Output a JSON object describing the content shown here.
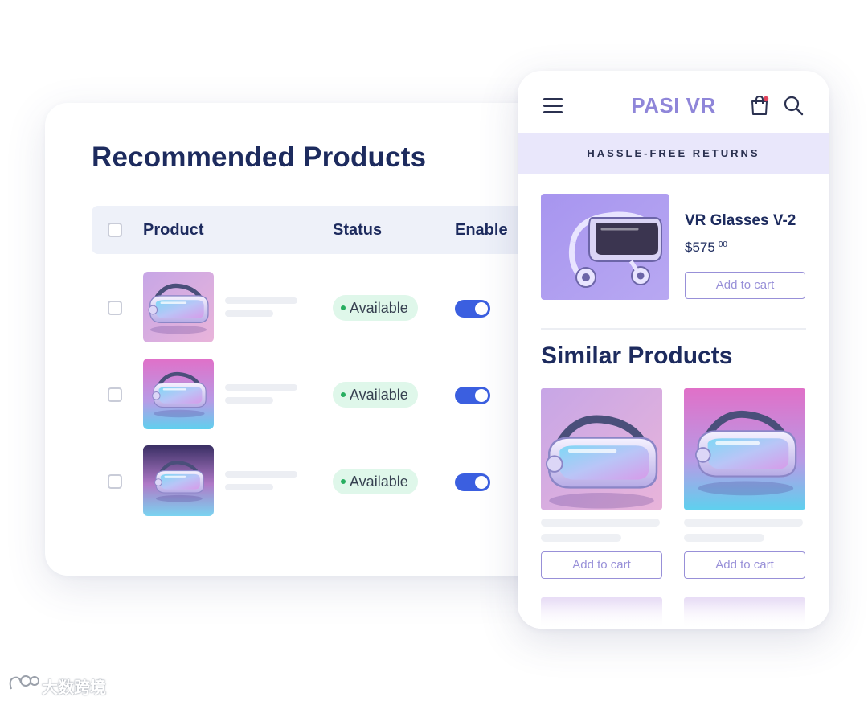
{
  "admin": {
    "title": "Recommended Products",
    "columns": {
      "product": "Product",
      "status": "Status",
      "enable": "Enable"
    },
    "rows": [
      {
        "status": "Available",
        "enabled": true
      },
      {
        "status": "Available",
        "enabled": true
      },
      {
        "status": "Available",
        "enabled": true
      }
    ]
  },
  "shop": {
    "brand": "PASI VR",
    "banner": "HASSLE-FREE RETURNS",
    "featured": {
      "name": "VR Glasses V-2",
      "price": "$575",
      "cents": "00",
      "button": "Add to cart"
    },
    "similar_title": "Similar Products",
    "similar": [
      {
        "button": "Add to cart"
      },
      {
        "button": "Add to cart"
      }
    ],
    "icons": [
      "hamburger-menu-icon",
      "shopping-bag-icon",
      "search-icon"
    ],
    "colors": {
      "brand": "#8f86d9",
      "banner_bg": "#e9e7fb",
      "toggle": "#3b5fe0",
      "badge_bg": "#dff7ea",
      "badge_dot": "#27ae60"
    }
  },
  "watermark": {
    "text": "大数跨境"
  }
}
